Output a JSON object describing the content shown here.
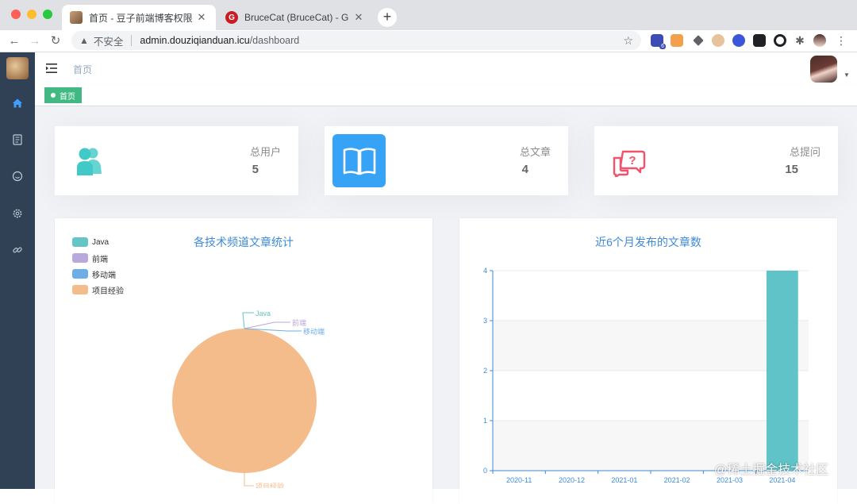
{
  "browser": {
    "tabs": [
      {
        "title": "首页 - 豆子前端博客权限管理系统",
        "active": true
      },
      {
        "title": "BruceCat (BruceCat) - Gitee.com",
        "active": false
      }
    ],
    "url_warning": "不安全",
    "url_host": "admin.douziqianduan.icu",
    "url_path": "/dashboard",
    "extension_badge": "6"
  },
  "navbar": {
    "breadcrumb": "首页"
  },
  "tags": {
    "active": "首页"
  },
  "cards": [
    {
      "label": "总用户",
      "value": "5",
      "icon": "users-icon",
      "color": "#40c9c6"
    },
    {
      "label": "总文章",
      "value": "4",
      "icon": "book-icon",
      "color": "#36a3f7"
    },
    {
      "label": "总提问",
      "value": "15",
      "icon": "question-chat-icon",
      "color": "#f4516c"
    }
  ],
  "pie": {
    "title": "各技术频道文章统计",
    "chart_data": {
      "type": "pie",
      "title": "各技术频道文章统计",
      "labels": [
        "Java",
        "前端",
        "移动端",
        "项目经验"
      ],
      "values": [
        0,
        0,
        0,
        4
      ],
      "colors": [
        "#64c5c6",
        "#b8a8dc",
        "#6daee6",
        "#f4bb8b"
      ],
      "legend": "top-left"
    }
  },
  "bar": {
    "title": "近6个月发布的文章数",
    "chart_data": {
      "type": "bar",
      "title": "近6个月发布的文章数",
      "categories": [
        "2020-11",
        "2020-12",
        "2021-01",
        "2021-02",
        "2021-03",
        "2021-04"
      ],
      "values": [
        0,
        0,
        0,
        0,
        0,
        4
      ],
      "ylim": [
        0,
        4
      ],
      "yticks": [
        "0",
        "1",
        "2",
        "3",
        "4"
      ],
      "color": "#5fc3c8"
    }
  },
  "watermark": "@稀土掘金技术社区"
}
